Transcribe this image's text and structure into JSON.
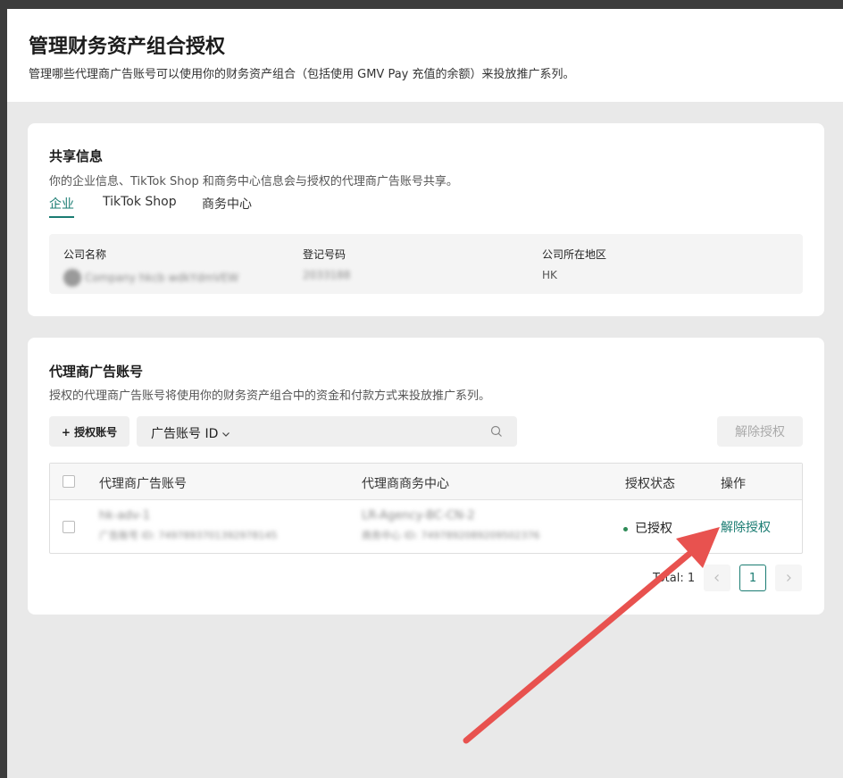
{
  "dialog": {
    "title": "管理财务资产组合授权",
    "description": "管理哪些代理商广告账号可以使用你的财务资产组合（包括使用 GMV Pay 充值的余额）来投放推广系列。"
  },
  "share_info": {
    "title": "共享信息",
    "description": "你的企业信息、TikTok Shop 和商务中心信息会与授权的代理商广告账号共享。",
    "tabs": [
      {
        "label": "企业",
        "active": true
      },
      {
        "label": "TikTok Shop",
        "active": false
      },
      {
        "label": "商务中心",
        "active": false
      }
    ],
    "fields": [
      {
        "label": "公司名称",
        "value": "Company hkcb wdkYdmVEW",
        "blurred": true
      },
      {
        "label": "登记号码",
        "value": "2033188",
        "blurred": true
      },
      {
        "label": "公司所在地区",
        "value": "HK",
        "blurred": false
      }
    ]
  },
  "agency": {
    "title": "代理商广告账号",
    "description": "授权的代理商广告账号将使用你的财务资产组合中的资金和付款方式来投放推广系列。",
    "add_button": "+ 授权账号",
    "search_type": "广告账号 ID",
    "revoke_all_button": "解除授权",
    "columns": [
      "代理商广告账号",
      "代理商商务中心",
      "授权状态",
      "操作"
    ],
    "rows": [
      {
        "account_name": "hk-adv-1",
        "account_id": "广告账号 ID: 7497893701392978145",
        "bc_name": "LR-Agency-BC-CN-2",
        "bc_id": "商务中心 ID: 7497892089209502376",
        "status": "已授权",
        "action": "解除授权"
      }
    ],
    "total_label": "Total: 1",
    "current_page": "1"
  },
  "colors": {
    "accent": "#1a7c72",
    "status_ok": "#2e8b57",
    "arrow": "#e8524f"
  },
  "icons": [
    "search-icon",
    "chevron-down-icon",
    "chevron-left-icon",
    "chevron-right-icon",
    "arrow-annotation"
  ]
}
